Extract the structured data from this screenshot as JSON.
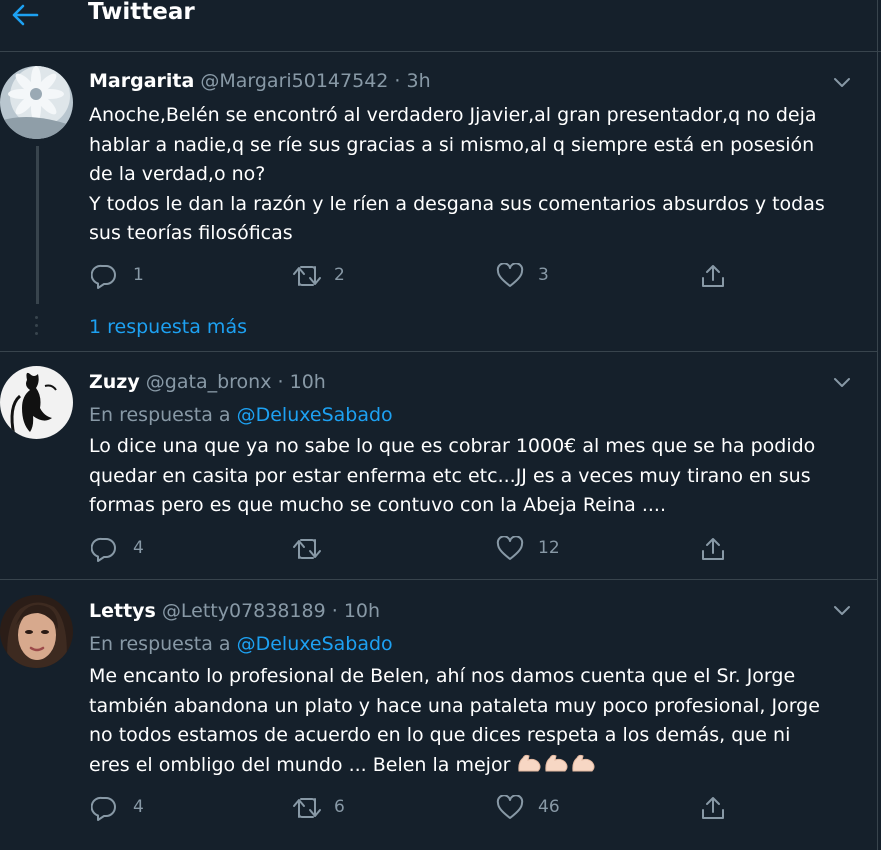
{
  "header": {
    "title": "Twittear",
    "accent_color": "#1da1f2"
  },
  "tweets": [
    {
      "name": "Margarita",
      "handle": "@Margari50147542",
      "time": "3h",
      "separator": "·",
      "body": [
        "Anoche,Belén se encontró al verdadero Jjavier,al gran presentador,q no deja",
        "hablar a nadie,q se ríe sus gracias a si mismo,al q siempre está en posesión",
        "de la verdad,o no?",
        "Y todos le dan la razón y le ríen a desgana sus comentarios absurdos y todas",
        "sus teorías filosóficas"
      ],
      "replies": "1",
      "retweets": "2",
      "likes": "3"
    },
    {
      "name": "Zuzy",
      "handle": "@gata_bronx",
      "time": "10h",
      "separator": "·",
      "reply_prefix": "En respuesta a",
      "reply_to": "@DeluxeSabado",
      "body": [
        "Lo dice una que ya no sabe lo que es cobrar 1000€ al mes que se ha podido",
        "quedar en casita por estar enferma etc etc...JJ es a veces muy tirano en sus",
        "formas pero es que mucho se contuvo con la Abeja Reina ...."
      ],
      "replies": "4",
      "retweets": "",
      "likes": "12"
    },
    {
      "name": "Lettys",
      "handle": "@Letty07838189",
      "time": "10h",
      "separator": "·",
      "reply_prefix": "En respuesta a",
      "reply_to": "@DeluxeSabado",
      "body": [
        "Me encanto lo profesional de Belen, ahí nos damos cuenta que el Sr. Jorge",
        "también abandona un plato y hace una pataleta muy poco profesional, Jorge",
        "no todos estamos de acuerdo en lo que dices respeta a los demás, que ni",
        "eres el ombligo del mundo ... Belen la mejor"
      ],
      "emoji": "flexed-biceps x3",
      "replies": "4",
      "retweets": "6",
      "likes": "46"
    }
  ],
  "thread": {
    "more_replies": "1 respuesta más"
  },
  "icons": [
    "back-arrow-icon",
    "chevron-down-icon",
    "reply-icon",
    "retweet-icon",
    "like-icon",
    "share-icon"
  ]
}
